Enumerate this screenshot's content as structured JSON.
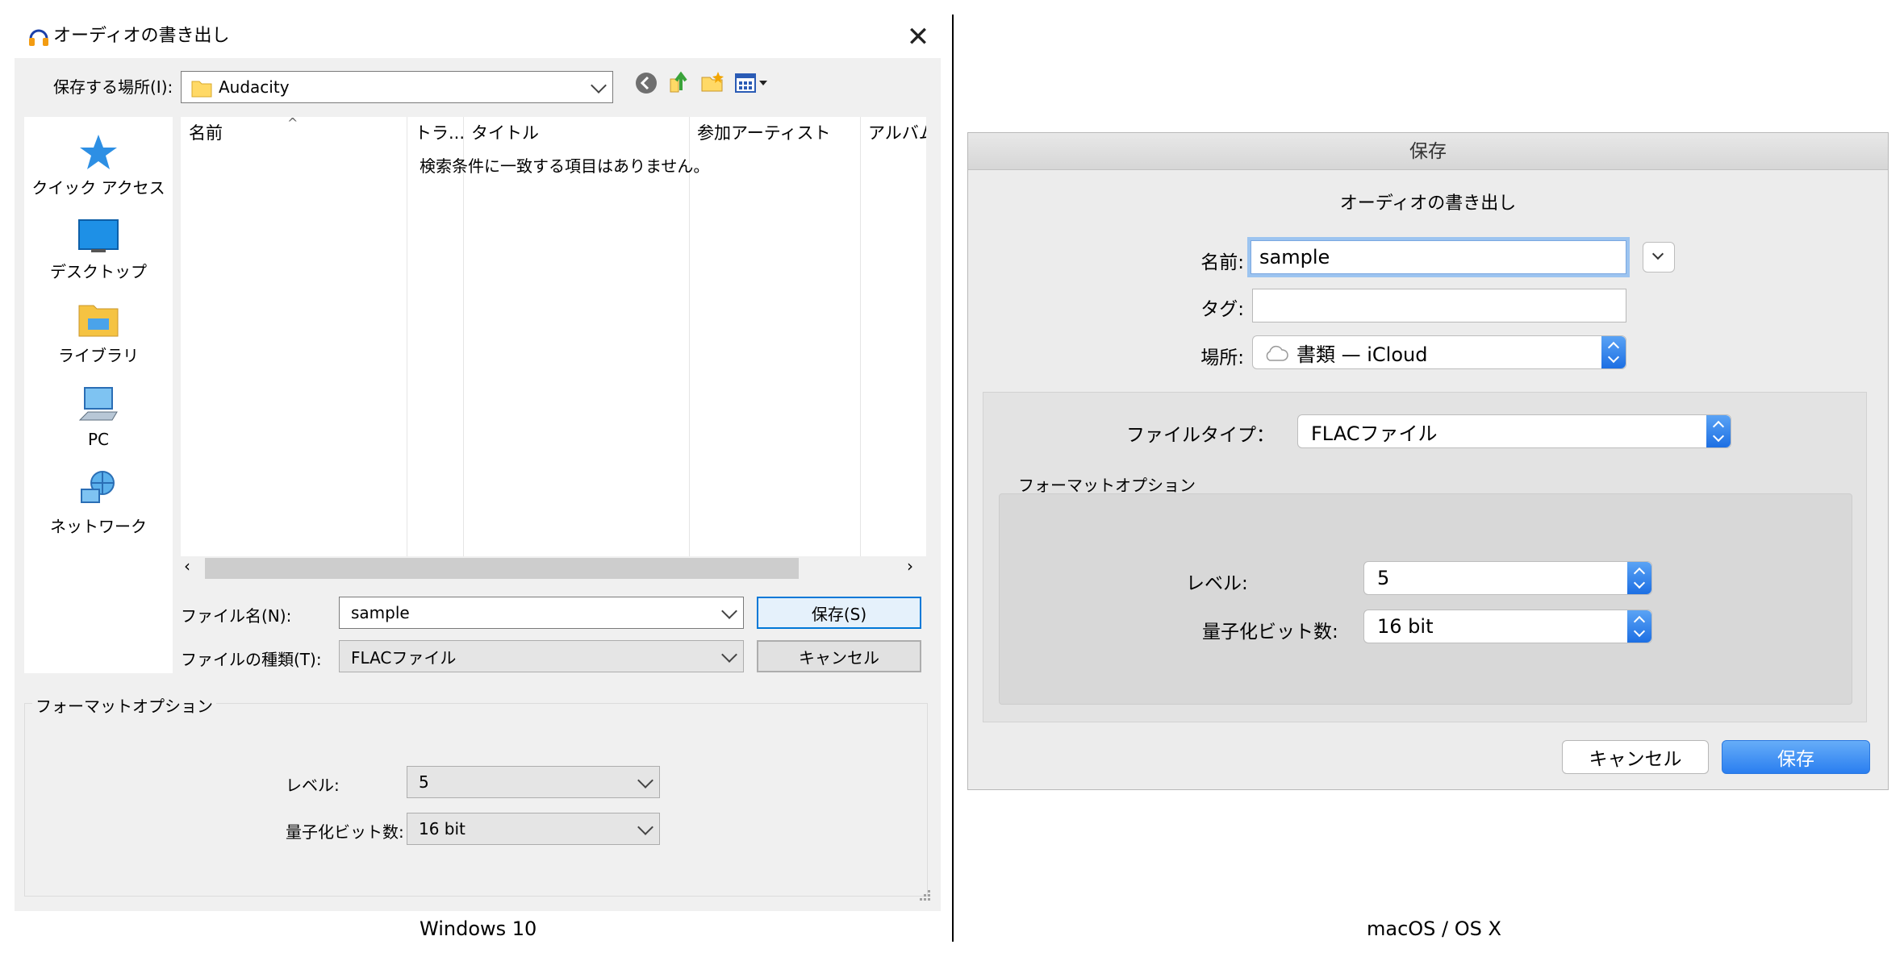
{
  "windows": {
    "title": "オーディオの書き出し",
    "save_in_label": "保存する場所(I):",
    "save_in_value": "Audacity",
    "places": [
      "クイック アクセス",
      "デスクトップ",
      "ライブラリ",
      "PC",
      "ネットワーク"
    ],
    "columns": [
      "名前",
      "トラ...",
      "タイトル",
      "参加アーティスト",
      "アルバム"
    ],
    "empty_message": "検索条件に一致する項目はありません。",
    "filename_label": "ファイル名(N):",
    "filename_value": "sample",
    "filetype_label": "ファイルの種類(T):",
    "filetype_value": "FLACファイル",
    "save_button": "保存(S)",
    "cancel_button": "キャンセル",
    "format_options_title": "フォーマットオプション",
    "level_label": "レベル:",
    "level_value": "5",
    "bitdepth_label": "量子化ビット数:",
    "bitdepth_value": "16 bit",
    "caption": "Windows 10"
  },
  "mac": {
    "window_title": "保存",
    "dialog_heading": "オーディオの書き出し",
    "name_label": "名前:",
    "name_value": "sample",
    "tags_label": "タグ:",
    "tags_value": "",
    "location_label": "場所:",
    "location_value": "書類 — iCloud",
    "filetype_label": "ファイルタイプ：",
    "filetype_value": "FLACファイル",
    "format_options_title": "フォーマットオプション",
    "level_label": "レベル:",
    "level_value": "5",
    "bitdepth_label": "量子化ビット数:",
    "bitdepth_value": "16 bit",
    "cancel_button": "キャンセル",
    "save_button": "保存",
    "caption": "macOS / OS X"
  }
}
